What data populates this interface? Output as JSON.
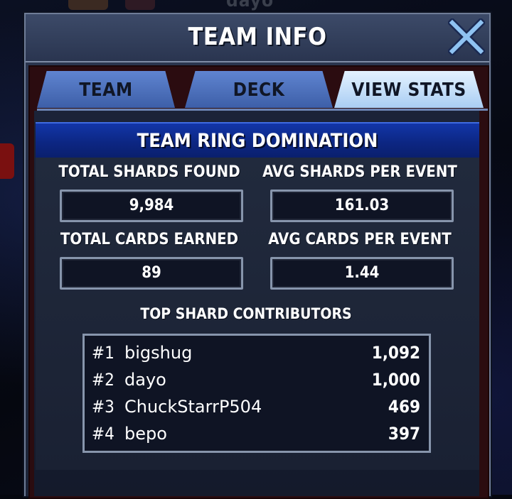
{
  "background": {
    "ghost_name": "dayo"
  },
  "window": {
    "title": "TEAM INFO",
    "close_icon": "close-x-icon"
  },
  "tabs": [
    {
      "label": "TEAM",
      "active": false
    },
    {
      "label": "DECK",
      "active": false
    },
    {
      "label": "VIEW STATS",
      "active": true
    }
  ],
  "section": {
    "title": "TEAM RING DOMINATION"
  },
  "stats": {
    "total_shards_found": {
      "label": "TOTAL SHARDS FOUND",
      "value": "9,984"
    },
    "avg_shards_per_event": {
      "label": "AVG SHARDS PER EVENT",
      "value": "161.03"
    },
    "total_cards_earned": {
      "label": "TOTAL CARDS EARNED",
      "value": "89"
    },
    "avg_cards_per_event": {
      "label": "AVG CARDS PER EVENT",
      "value": "1.44"
    }
  },
  "contributors": {
    "title": "TOP SHARD CONTRIBUTORS",
    "rows": [
      {
        "rank": "#1",
        "name": "bigshug",
        "shards": "1,092"
      },
      {
        "rank": "#2",
        "name": "dayo",
        "shards": "1,000"
      },
      {
        "rank": "#3",
        "name": "ChuckStarrP504",
        "shards": "469"
      },
      {
        "rank": "#4",
        "name": "bepo",
        "shards": "397"
      }
    ]
  },
  "colors": {
    "panel": "#2a3550",
    "section_header": "#0c2682",
    "tab_inactive": "#4a6fbf",
    "tab_active": "#cfe6fb",
    "frame_accent": "#2b0c10"
  }
}
